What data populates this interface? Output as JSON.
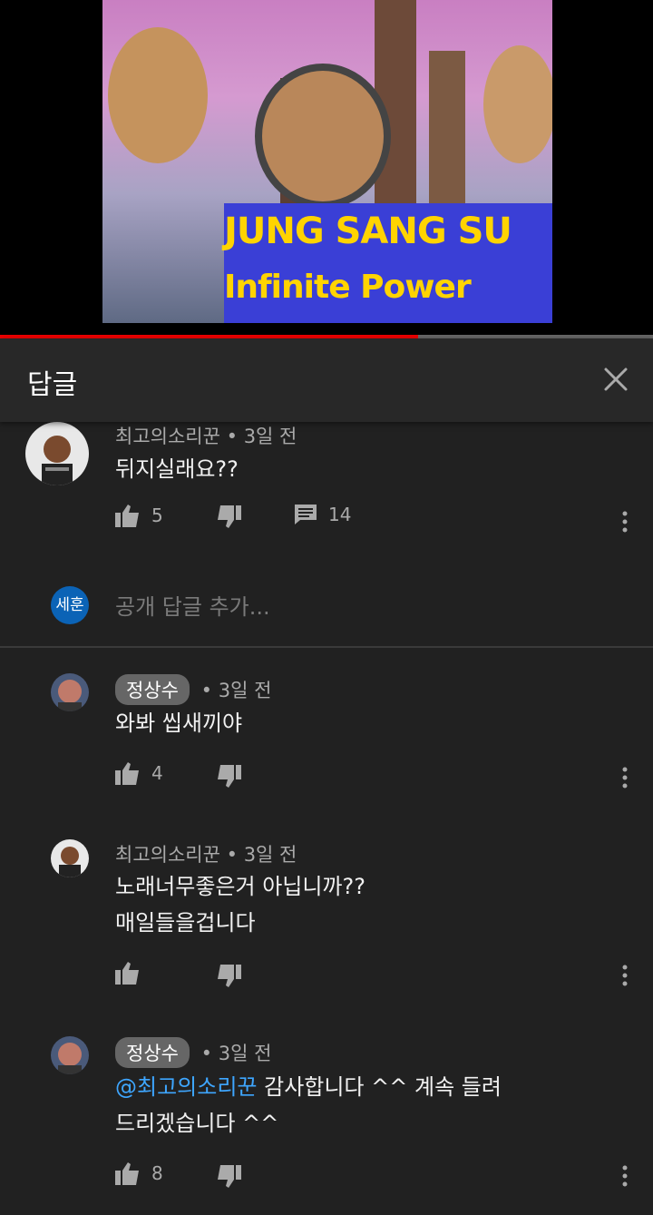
{
  "video": {
    "title_line1": "JUNG SANG SU",
    "title_line2": "Infinite Power",
    "progress": 0.64
  },
  "header": {
    "title": "답글"
  },
  "top_comment": {
    "author": "최고의소리꾼",
    "time": "3일 전",
    "text": "뒤지실래요??",
    "likes": "5",
    "replies": "14"
  },
  "reply_box": {
    "avatar_text": "세훈",
    "placeholder": "공개 답글 추가..."
  },
  "replies": [
    {
      "author": "정상수",
      "author_is_creator": true,
      "time": "3일 전",
      "lines": [
        "와봐 씹새끼야"
      ],
      "likes": "4"
    },
    {
      "author": "최고의소리꾼",
      "author_is_creator": false,
      "time": "3일 전",
      "lines": [
        "노래너무좋은거 아닙니까??",
        "매일들을겁니다"
      ],
      "likes": ""
    },
    {
      "author": "정상수",
      "author_is_creator": true,
      "time": "3일 전",
      "mention": "@최고의소리꾼",
      "lines": [
        " 감사합니다 ^^ 계속 들려",
        "드리겠습니다 ^^"
      ],
      "likes": "8"
    }
  ],
  "separator": "•"
}
